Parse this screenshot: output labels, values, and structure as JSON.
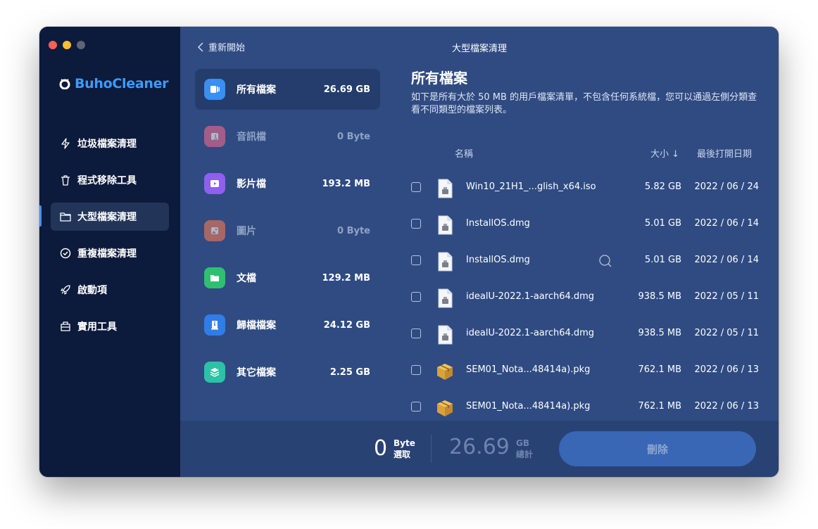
{
  "app": {
    "name": "BuhoCleaner",
    "brand_color": "#3b9bff"
  },
  "sidebar": {
    "items": [
      {
        "label": "垃圾檔案清理",
        "icon": "bolt-icon",
        "active": false
      },
      {
        "label": "程式移除工具",
        "icon": "trash-icon",
        "active": false
      },
      {
        "label": "大型檔案清理",
        "icon": "folder-icon",
        "active": true
      },
      {
        "label": "重複檔案清理",
        "icon": "check-circle-icon",
        "active": false
      },
      {
        "label": "啟動項",
        "icon": "rocket-icon",
        "active": false
      },
      {
        "label": "實用工具",
        "icon": "toolbox-icon",
        "active": false
      }
    ]
  },
  "header": {
    "back_label": "重新開始",
    "title": "大型檔案清理"
  },
  "categories": [
    {
      "label": "所有檔案",
      "size": "26.69 GB",
      "icon": "all-files-icon",
      "color": "#3a8ff0",
      "active": true
    },
    {
      "label": "音訊檔",
      "size": "0 Byte",
      "icon": "music-icon",
      "color": "#f06a8c",
      "active": false
    },
    {
      "label": "影片檔",
      "size": "193.2 MB",
      "icon": "video-icon",
      "color": "#8f5ff0",
      "active": false
    },
    {
      "label": "圖片",
      "size": "0 Byte",
      "icon": "image-icon",
      "color": "#f57b52",
      "active": false
    },
    {
      "label": "文檔",
      "size": "129.2 MB",
      "icon": "document-icon",
      "color": "#2fbf71",
      "active": false
    },
    {
      "label": "歸檔檔案",
      "size": "24.12 GB",
      "icon": "archive-icon",
      "color": "#2f7de8",
      "active": false
    },
    {
      "label": "其它檔案",
      "size": "2.25 GB",
      "icon": "layers-icon",
      "color": "#2dc1a6",
      "active": false
    }
  ],
  "content": {
    "heading": "所有檔案",
    "description": "如下是所有大於 50 MB 的用戶檔案清單，不包含任何系統檔，您可以通過左側分類查看不同類型的檔案列表。"
  },
  "table": {
    "columns": {
      "name": "名稱",
      "size": "大小 ↓",
      "date": "最後打開日期"
    },
    "rows": [
      {
        "name": "Win10_21H1_...glish_x64.iso",
        "size": "5.82 GB",
        "date": "2022 / 06 / 24",
        "icon": "disk-image-file-icon",
        "checked": false
      },
      {
        "name": "InstallOS.dmg",
        "size": "5.01 GB",
        "date": "2022 / 06 / 14",
        "icon": "disk-image-file-icon",
        "checked": false
      },
      {
        "name": "InstallOS.dmg",
        "size": "5.01 GB",
        "date": "2022 / 06 / 14",
        "icon": "disk-image-file-icon",
        "checked": false,
        "hover": true
      },
      {
        "name": "idealU-2022.1-aarch64.dmg",
        "size": "938.5 MB",
        "date": "2022 / 05 / 11",
        "icon": "disk-image-file-icon",
        "checked": false
      },
      {
        "name": "idealU-2022.1-aarch64.dmg",
        "size": "938.5 MB",
        "date": "2022 / 05 / 11",
        "icon": "disk-image-file-icon",
        "checked": false
      },
      {
        "name": "SEM01_Nota...48414a).pkg",
        "size": "762.1 MB",
        "date": "2022 / 06 / 13",
        "icon": "package-icon",
        "checked": false
      },
      {
        "name": "SEM01_Nota...48414a).pkg",
        "size": "762.1 MB",
        "date": "2022 / 06 / 13",
        "icon": "package-icon",
        "checked": false
      }
    ]
  },
  "footer": {
    "selected_value": "0",
    "selected_unit": "Byte",
    "selected_label": "選取",
    "total_value": "26.69",
    "total_unit": "GB",
    "total_label": "總計",
    "delete_label": "刪除"
  }
}
